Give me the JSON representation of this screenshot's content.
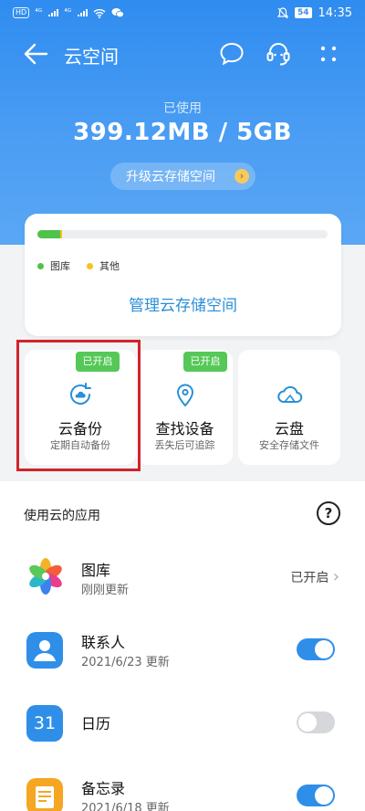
{
  "status_bar": {
    "carrier_chip": "HD",
    "signal_a": "⁴ᴳ",
    "signal_b": "⁴ᴳ",
    "battery": "54",
    "time": "14:35"
  },
  "header": {
    "title": "云空间"
  },
  "storage": {
    "used_label": "已使用",
    "used_value": "399.12MB / 5GB",
    "upgrade_label": "升级云存储空间",
    "gallery_fraction": 0.08,
    "other_fraction": 0.004,
    "legend": [
      {
        "label": "图库",
        "color": "#4ec24a"
      },
      {
        "label": "其他",
        "color": "#f7c21b"
      }
    ],
    "manage_label": "管理云存储空间"
  },
  "services": [
    {
      "title": "云备份",
      "subtitle": "定期自动备份",
      "badge": "已开启",
      "icon": "cloud-backup-icon"
    },
    {
      "title": "查找设备",
      "subtitle": "丢失后可追踪",
      "badge": "已开启",
      "icon": "location-pin-icon"
    },
    {
      "title": "云盘",
      "subtitle": "安全存储文件",
      "badge": "",
      "icon": "cloud-icon"
    }
  ],
  "apps": {
    "section_title": "使用云的应用",
    "help_label": "?",
    "items": [
      {
        "name": "图库",
        "subtitle": "刚刚更新",
        "status": "已开启",
        "control": "link",
        "icon": "gallery-icon"
      },
      {
        "name": "联系人",
        "subtitle": "2021/6/23 更新",
        "status": "",
        "control": "toggle",
        "enabled": true,
        "icon": "contacts-icon"
      },
      {
        "name": "日历",
        "subtitle": "",
        "status": "",
        "control": "toggle",
        "enabled": false,
        "icon": "calendar-icon",
        "icon_text": "31"
      },
      {
        "name": "备忘录",
        "subtitle": "2021/6/18 更新",
        "status": "",
        "control": "toggle",
        "enabled": true,
        "icon": "notes-icon"
      }
    ]
  }
}
